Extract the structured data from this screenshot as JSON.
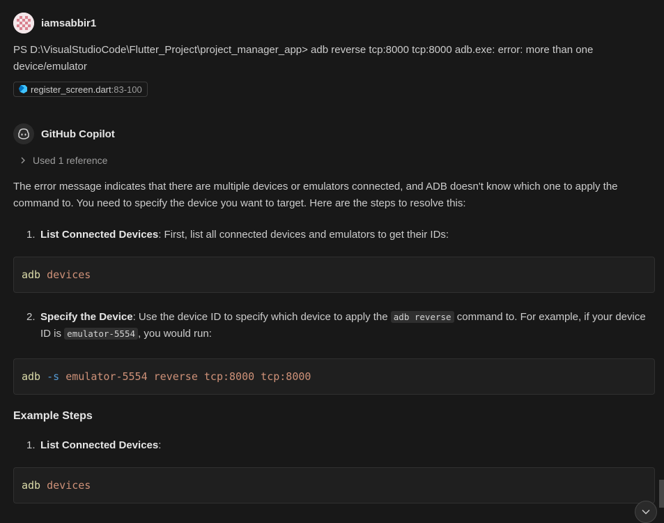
{
  "user_message": {
    "username": "iamsabbir1",
    "text": "PS D:\\VisualStudioCode\\Flutter_Project\\project_manager_app> adb reverse tcp:8000 tcp:8000 adb.exe: error: more than one device/emulator",
    "attachment": {
      "file": "register_screen.dart",
      "range": ":83-100",
      "icon": "dart-icon"
    }
  },
  "copilot_message": {
    "name": "GitHub Copilot",
    "references_label": "Used 1 reference",
    "intro": "The error message indicates that there are multiple devices or emulators connected, and ADB doesn't know which one to apply the command to. You need to specify the device you want to target. Here are the steps to resolve this:",
    "step1": {
      "num": "1.",
      "title": "List Connected Devices",
      "text": ": First, list all connected devices and emulators to get their IDs:"
    },
    "code1": {
      "cmd": "adb",
      "args": "devices"
    },
    "step2": {
      "num": "2.",
      "title": "Specify the Device",
      "text_a": ": Use the device ID to specify which device to apply the ",
      "code_a": "adb reverse",
      "text_b": " command to. For example, if your device ID is ",
      "code_b": "emulator-5554",
      "text_c": ", you would run:"
    },
    "code2": {
      "cmd": "adb",
      "flag": "-s",
      "args": "emulator-5554 reverse tcp:8000 tcp:8000"
    },
    "example_heading": "Example Steps",
    "example_step1": {
      "num": "1.",
      "title": "List Connected Devices",
      "text": ":"
    },
    "code3": {
      "cmd": "adb",
      "args": "devices"
    }
  },
  "colors": {
    "background": "#181818",
    "text": "#cccccc",
    "code_string": "#ce9178",
    "code_command": "#dcdcaa",
    "code_flag": "#569cd6"
  }
}
